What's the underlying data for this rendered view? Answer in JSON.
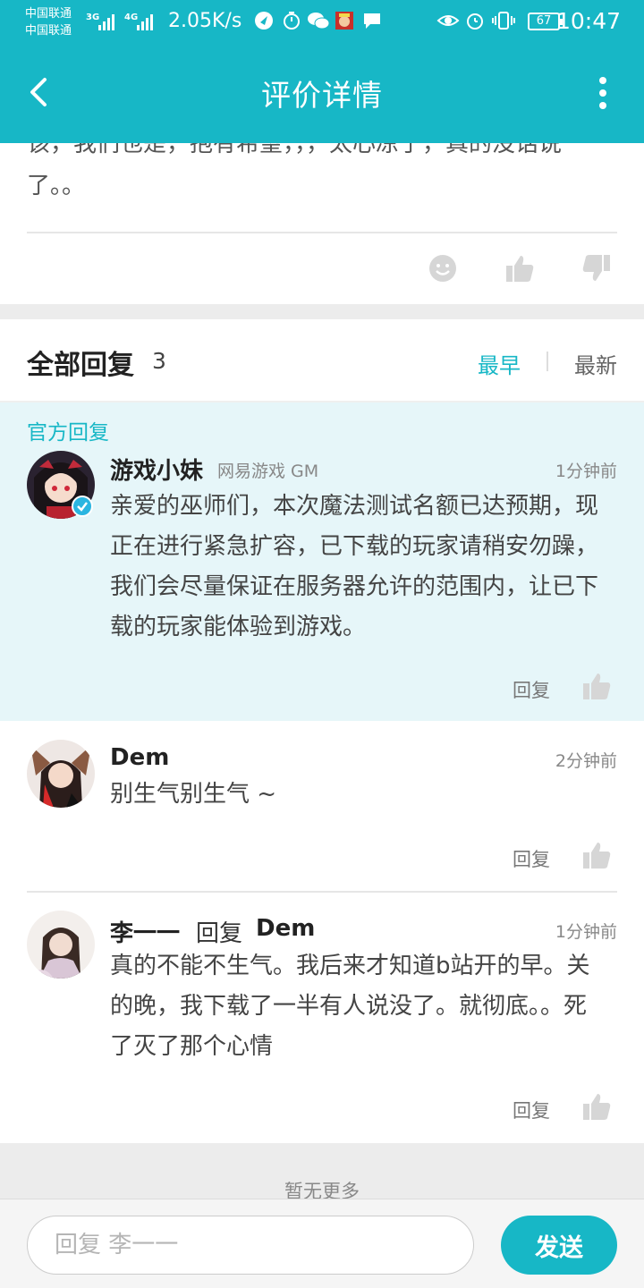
{
  "status_bar": {
    "carrier1": "中国联通",
    "carrier2": "中国联通",
    "net1": "3G",
    "net2": "4G",
    "speed": "2.05K/s",
    "battery": "67",
    "time": "10:47"
  },
  "header": {
    "title": "评价详情"
  },
  "review": {
    "tail_text": "该，我们也是，抱有希望，，，太心凉了，真的没话说了。。"
  },
  "replies": {
    "title": "全部回复",
    "count": "3",
    "sort_earliest": "最早",
    "sort_latest": "最新"
  },
  "official": {
    "label": "官方回复",
    "name": "游戏小妹",
    "subtitle": "网易游戏 GM",
    "time": "1分钟前",
    "text": "亲爱的巫师们，本次魔法测试名额已达预期，现正在进行紧急扩容，已下载的玩家请稍安勿躁，我们会尽量保证在服务器允许的范围内，让已下载的玩家能体验到游戏。",
    "reply_label": "回复"
  },
  "comments": [
    {
      "name": "Dem",
      "time": "2分钟前",
      "text": "别生气别生气 ~",
      "reply_label": "回复"
    },
    {
      "name": "李一一",
      "reply_word": "回复",
      "reply_to": "Dem",
      "time": "1分钟前",
      "text": "真的不能不生气。我后来才知道b站开的早。关的晚，我下载了一半有人说没了。就彻底。。死了灭了那个心情",
      "reply_label": "回复"
    }
  ],
  "footer": {
    "no_more": "暂无更多"
  },
  "input_bar": {
    "placeholder": "回复 李一一",
    "send_label": "发送"
  },
  "colors": {
    "accent": "#17b7c6",
    "official_bg": "#e6f6f9"
  }
}
